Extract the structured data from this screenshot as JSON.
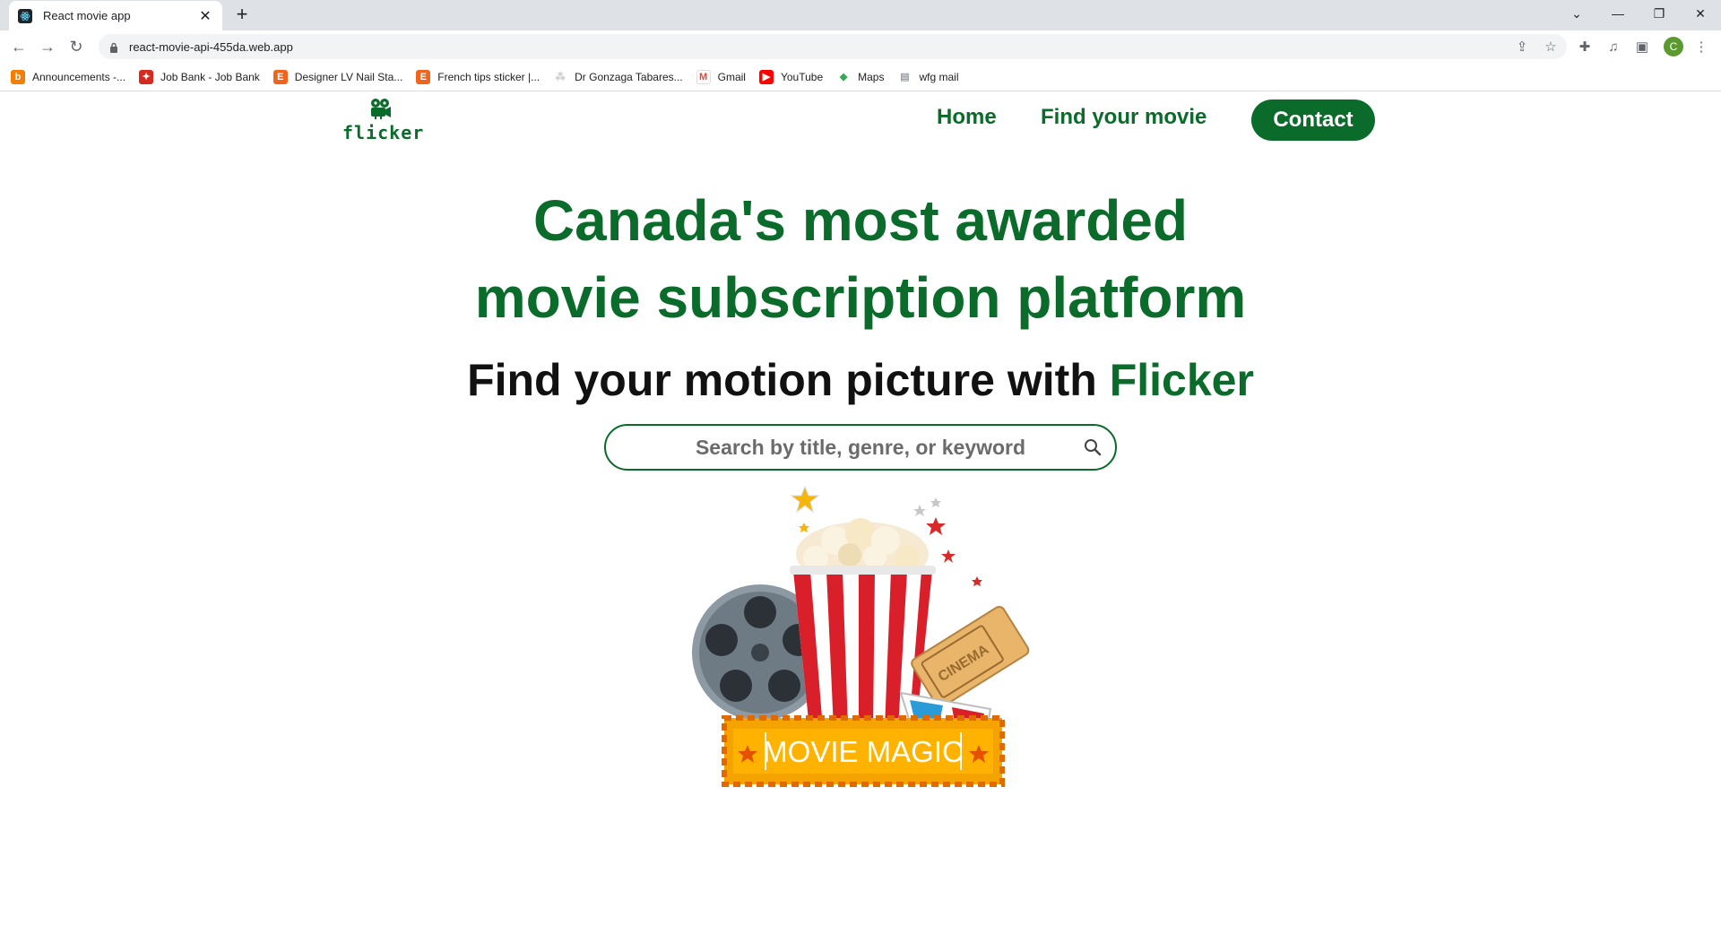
{
  "browser": {
    "tab_title": "React movie app",
    "url": "react-movie-api-455da.web.app",
    "profile_initial": "C",
    "bookmarks": [
      {
        "label": "Announcements -...",
        "icon": "blogger-icon",
        "color": "#f57d00",
        "glyph": "b"
      },
      {
        "label": "Job Bank - Job Bank",
        "icon": "maple-leaf-icon",
        "color": "#d52b1e",
        "glyph": "✦"
      },
      {
        "label": "Designer LV Nail Sta...",
        "icon": "etsy-icon",
        "color": "#f1641e",
        "glyph": "E"
      },
      {
        "label": "French tips sticker |...",
        "icon": "etsy-icon",
        "color": "#f1641e",
        "glyph": "E"
      },
      {
        "label": "Dr Gonzaga Tabares...",
        "icon": "broken-image-icon",
        "color": "#c9c9c9",
        "glyph": "⁂"
      },
      {
        "label": "Gmail",
        "icon": "gmail-icon",
        "color": "#ffffff",
        "glyph": "M"
      },
      {
        "label": "YouTube",
        "icon": "youtube-icon",
        "color": "#ff0000",
        "glyph": "▶"
      },
      {
        "label": "Maps",
        "icon": "maps-icon",
        "color": "#34a853",
        "glyph": "◆"
      },
      {
        "label": "wfg mail",
        "icon": "page-icon",
        "color": "#9aa0a6",
        "glyph": "▤"
      }
    ]
  },
  "site": {
    "logo_text": "flicker",
    "nav": {
      "home": "Home",
      "find": "Find your movie",
      "contact": "Contact"
    },
    "hero_line1": "Canada's most awarded",
    "hero_line2": "movie subscription platform",
    "subtitle_prefix": "Find your motion picture with ",
    "subtitle_brand": "Flicker",
    "search_placeholder": "Search by title, genre, or keyword",
    "banner_text": "MOVIE MAGIC",
    "ticket_text": "CINEMA"
  },
  "colors": {
    "brand_green": "#0a6b2b"
  }
}
